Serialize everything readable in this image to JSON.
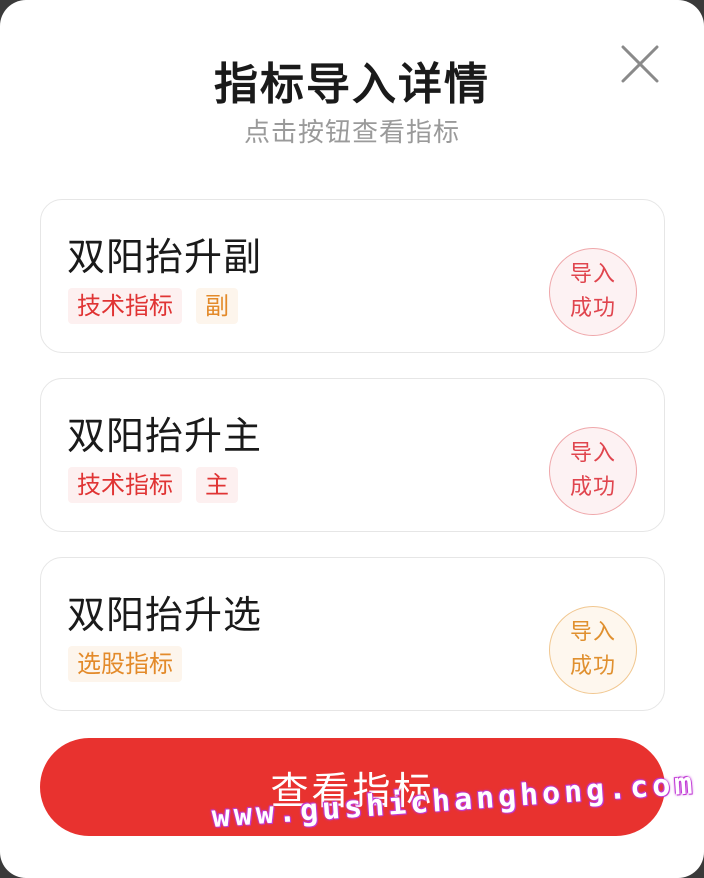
{
  "dialog": {
    "title": "指标导入详情",
    "subtitle": "点击按钮查看指标",
    "close_icon": "close-icon"
  },
  "items": [
    {
      "name": "双阳抬升副",
      "tags": [
        {
          "label": "技术指标",
          "color": "red"
        },
        {
          "label": "副",
          "color": "orange"
        }
      ],
      "status_line1": "导入",
      "status_line2": "成功",
      "status_color": "red"
    },
    {
      "name": "双阳抬升主",
      "tags": [
        {
          "label": "技术指标",
          "color": "red"
        },
        {
          "label": "主",
          "color": "red"
        }
      ],
      "status_line1": "导入",
      "status_line2": "成功",
      "status_color": "red"
    },
    {
      "name": "双阳抬升选",
      "tags": [
        {
          "label": "选股指标",
          "color": "orange"
        }
      ],
      "status_line1": "导入",
      "status_line2": "成功",
      "status_color": "orange"
    }
  ],
  "footer": {
    "view_button_label": "查看指标"
  },
  "watermark": "www.gushichanghong.com",
  "colors": {
    "accent_red": "#e8322f",
    "tag_red": "#e03434",
    "tag_orange": "#e38a2a"
  }
}
